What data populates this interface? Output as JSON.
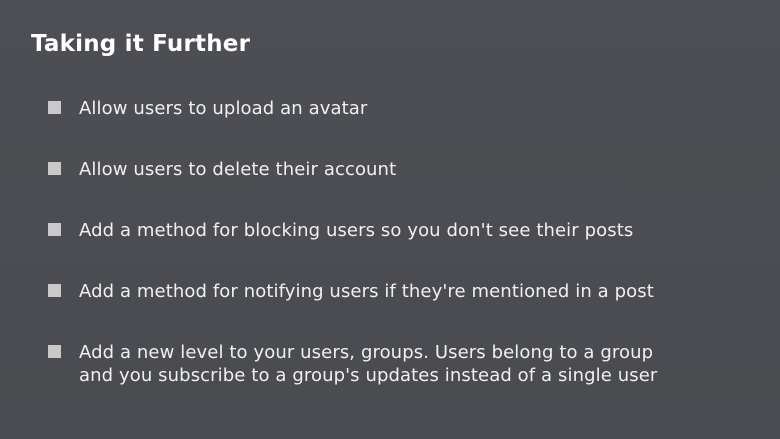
{
  "slide": {
    "title": "Taking it Further",
    "bullets": [
      {
        "lines": [
          "Allow users to upload an avatar"
        ]
      },
      {
        "lines": [
          "Allow users to delete their account"
        ]
      },
      {
        "lines": [
          "Add a method for blocking users so you don't see their posts"
        ]
      },
      {
        "lines": [
          "Add a method for notifying users if they're mentioned in a post"
        ]
      },
      {
        "lines": [
          "Add a new level to your users, groups. Users belong to a group",
          "and you subscribe to a group's updates instead of a single user"
        ]
      }
    ]
  },
  "colors": {
    "background": "#4b4d52",
    "title_text": "#ffffff",
    "bullet_text": "#f0f0f0",
    "bullet_marker": "#c9c9c9"
  }
}
